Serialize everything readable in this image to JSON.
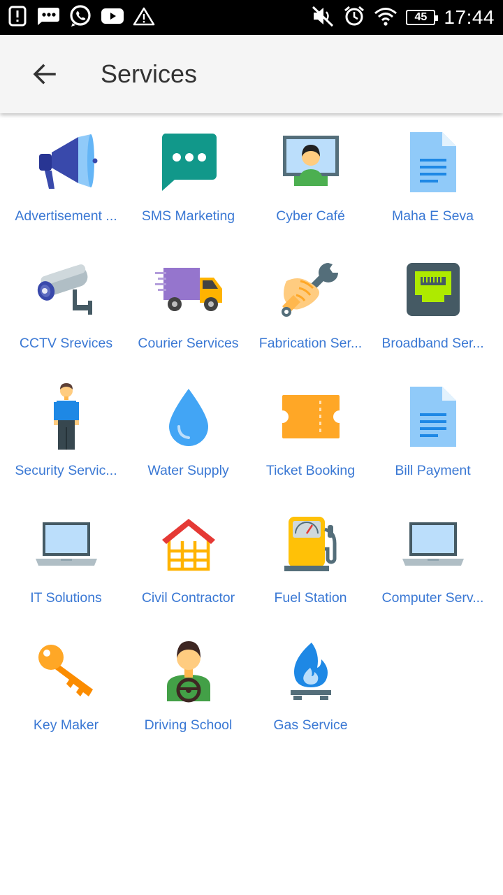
{
  "status_bar": {
    "time": "17:44",
    "battery": "45",
    "left_icons": [
      "alert-box-icon",
      "message-dots-icon",
      "whatsapp-icon",
      "youtube-icon",
      "warning-icon"
    ],
    "right_icons": [
      "mute-icon",
      "alarm-icon",
      "wifi-icon",
      "battery-icon"
    ]
  },
  "toolbar": {
    "title": "Services",
    "back_icon": "arrow-left-icon"
  },
  "services": [
    {
      "label": "Advertisement ...",
      "icon": "megaphone-icon"
    },
    {
      "label": "SMS Marketing",
      "icon": "chat-bubble-icon"
    },
    {
      "label": "Cyber Café",
      "icon": "monitor-person-icon"
    },
    {
      "label": "Maha E Seva",
      "icon": "document-icon"
    },
    {
      "label": "CCTV Srevices",
      "icon": "cctv-camera-icon"
    },
    {
      "label": "Courier Services",
      "icon": "delivery-truck-icon"
    },
    {
      "label": "Fabrication Ser...",
      "icon": "hand-wrench-icon"
    },
    {
      "label": "Broadband Ser...",
      "icon": "ethernet-port-icon"
    },
    {
      "label": "Security Servic...",
      "icon": "person-standing-icon"
    },
    {
      "label": "Water Supply",
      "icon": "water-drop-icon"
    },
    {
      "label": "Ticket Booking",
      "icon": "ticket-icon"
    },
    {
      "label": "Bill Payment",
      "icon": "document-icon"
    },
    {
      "label": "IT Solutions",
      "icon": "laptop-icon"
    },
    {
      "label": "Civil Contractor",
      "icon": "house-icon"
    },
    {
      "label": "Fuel Station",
      "icon": "fuel-pump-icon"
    },
    {
      "label": "Computer Serv...",
      "icon": "laptop-icon"
    },
    {
      "label": "Key Maker",
      "icon": "key-icon"
    },
    {
      "label": "Driving School",
      "icon": "driver-icon"
    },
    {
      "label": "Gas Service",
      "icon": "gas-flame-icon"
    }
  ]
}
